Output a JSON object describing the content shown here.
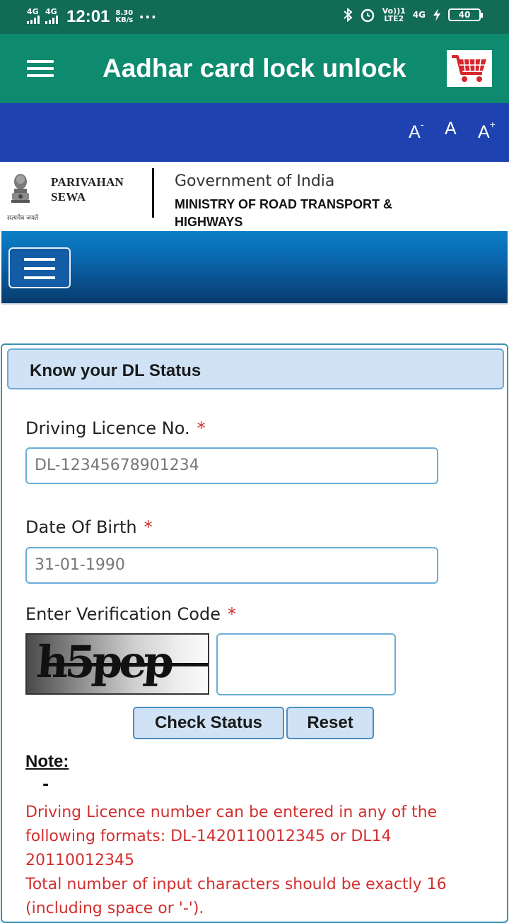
{
  "status_bar": {
    "network1": "4G",
    "network2": "4G",
    "time": "12:01",
    "speed_value": "8.30",
    "speed_unit": "KB/s",
    "more": "···",
    "volte": "Vo))1",
    "lte": "LTE2",
    "net_right": "4G",
    "battery": "40"
  },
  "app_bar": {
    "title": "Aadhar card lock unlock",
    "cart_icon": "cart-icon",
    "menu_icon": "menu-icon"
  },
  "font_controls": {
    "decrease": "A",
    "decrease_sup": "-",
    "normal": "A",
    "increase": "A",
    "increase_sup": "+"
  },
  "gov_header": {
    "brand_line1": "PARIVAHAN",
    "brand_line2": "SEWA",
    "emblem_motto": "सत्यमेव जयते",
    "gov_title": "Government of India",
    "ministry": "MINISTRY OF ROAD TRANSPORT & HIGHWAYS"
  },
  "form": {
    "heading": "Know your DL Status",
    "required_mark": "*",
    "dl_label": "Driving Licence No.",
    "dl_placeholder": "DL-12345678901234",
    "dob_label": "Date Of Birth",
    "dob_placeholder": "31-01-1990",
    "captcha_label": "Enter Verification Code",
    "captcha_text": "h5pep",
    "captcha_value": "",
    "check_button": "Check Status",
    "reset_button": "Reset"
  },
  "note": {
    "label": "Note:",
    "dash": "-",
    "line1": "Driving Licence number can be entered in any of the following formats: DL-1420110012345 or DL14 20110012345",
    "line2": "Total number of input characters should be exactly 16 (including space or '-')."
  },
  "colors": {
    "status_bar": "#126b55",
    "app_bar": "#0e8a6f",
    "blue_bar": "#1e43b0",
    "required": "#d32f2f",
    "input_border": "#6aaed6"
  }
}
